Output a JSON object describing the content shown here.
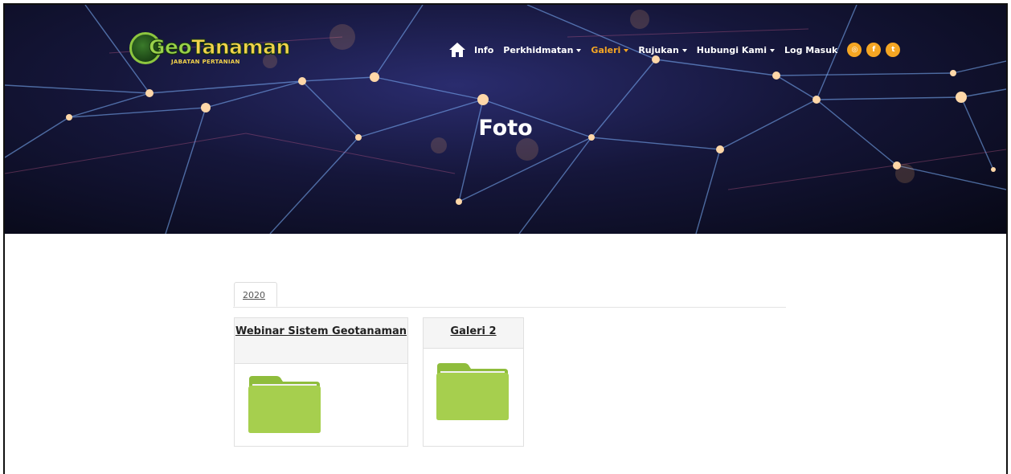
{
  "logo": {
    "text_g": "Geo",
    "text_rest": "Tanaman",
    "subtitle": "JABATAN PERTANIAN"
  },
  "nav": {
    "items": [
      {
        "label": "Info",
        "dropdown": false,
        "active": false
      },
      {
        "label": "Perkhidmatan",
        "dropdown": true,
        "active": false
      },
      {
        "label": "Galeri",
        "dropdown": true,
        "active": true
      },
      {
        "label": "Rujukan",
        "dropdown": true,
        "active": false
      },
      {
        "label": "Hubungi Kami",
        "dropdown": true,
        "active": false
      },
      {
        "label": "Log Masuk",
        "dropdown": false,
        "active": false
      }
    ],
    "social": [
      {
        "icon": "instagram-icon",
        "glyph": "◎"
      },
      {
        "icon": "facebook-icon",
        "glyph": "f"
      },
      {
        "icon": "twitter-icon",
        "glyph": "t"
      }
    ],
    "active_color": "#f5a623"
  },
  "hero": {
    "title": "Foto"
  },
  "tabs": [
    {
      "label": "2020",
      "active": true
    }
  ],
  "albums": [
    {
      "title": "Webinar Sistem Geotanaman"
    },
    {
      "title": "Galeri 2"
    }
  ],
  "colors": {
    "folder": "#a6cf4e",
    "accent": "#f5a623"
  }
}
